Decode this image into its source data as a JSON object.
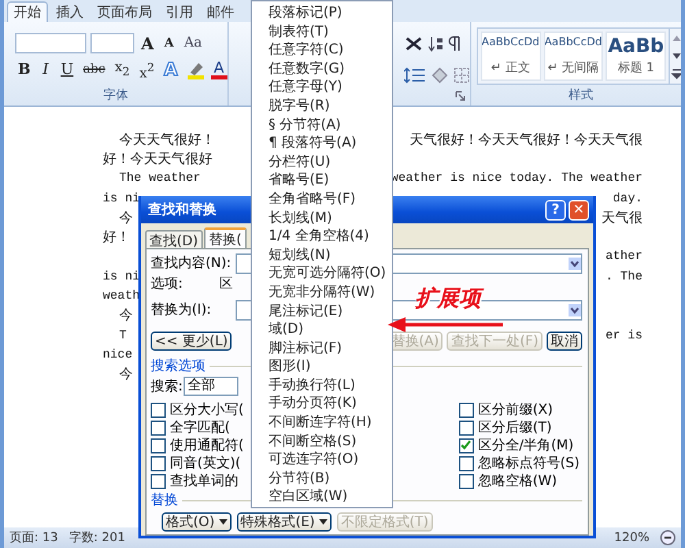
{
  "ribbon": {
    "tabs": [
      {
        "label": "开始",
        "selected": true
      },
      {
        "label": "插入",
        "selected": false
      },
      {
        "label": "页面布局",
        "selected": false
      },
      {
        "label": "引用",
        "selected": false
      },
      {
        "label": "邮件",
        "selected": false
      }
    ],
    "font_group": {
      "label": "字体",
      "row1": [
        {
          "kind": "grow",
          "text": "A"
        },
        {
          "kind": "shrink",
          "text": "A"
        },
        {
          "kind": "case",
          "text": "Aa"
        }
      ],
      "row2": [
        {
          "kind": "bold",
          "text": "B"
        },
        {
          "kind": "italic",
          "text": "I"
        },
        {
          "kind": "underline",
          "text": "U"
        },
        {
          "kind": "strike",
          "text": "abc"
        },
        {
          "kind": "plain",
          "text": "x$_{2}$"
        },
        {
          "kind": "plain",
          "text": "x$^{2}$"
        },
        {
          "kind": "effect",
          "text": "A"
        },
        {
          "kind": "highlight"
        },
        {
          "kind": "color",
          "text": "A"
        }
      ]
    },
    "styles": {
      "label": "样式",
      "items": [
        {
          "kind": "normal",
          "sample": "AaBbCcDd",
          "name": "↵ 正文"
        },
        {
          "kind": "normal",
          "sample": "AaBbCcDd",
          "name": "↵ 无间隔"
        },
        {
          "kind": "heading",
          "sample": "AaBb",
          "name": "标题 1"
        }
      ]
    }
  },
  "document": {
    "lines": [
      {
        "kind": "cjk",
        "indent": true,
        "left": "今天天气很好！",
        "right": "天气很好！今天天气很好！今天天气很"
      },
      {
        "kind": "cjk",
        "indent": false,
        "left": "好！今天天气很好"
      },
      {
        "kind": "latin",
        "indent": true,
        "left": "The weather",
        "right": "weather is nice today. The weather"
      },
      {
        "kind": "latin",
        "indent": false,
        "left": "is ni",
        "right": "day."
      },
      {
        "kind": "cjk",
        "indent": true,
        "left": "今",
        "right": "天气很"
      },
      {
        "kind": "cjk",
        "indent": false,
        "left": "好！"
      },
      {
        "kind": "latin",
        "indent": false,
        "right": "ather"
      },
      {
        "kind": "latin",
        "indent": false,
        "left": "is ni",
        "right": ". The"
      },
      {
        "kind": "latin",
        "indent": false,
        "left": "weath"
      },
      {
        "kind": "cjk",
        "indent": true,
        "left": "今"
      },
      {
        "kind": "latin",
        "indent": true,
        "left": "T",
        "right": "er is"
      },
      {
        "kind": "latin",
        "indent": false,
        "left": "nice"
      },
      {
        "kind": "cjk",
        "indent": true,
        "left": "今"
      }
    ]
  },
  "status_bar": {
    "page": "页面: 13",
    "words": "字数: 201",
    "zoom": "120%"
  },
  "dialog": {
    "title": "查找和替换",
    "title_buttons": [
      {
        "kind": "help",
        "text": "?"
      },
      {
        "kind": "close",
        "text": "✕"
      }
    ],
    "tabs": [
      {
        "label": "查找(D)",
        "selected": false
      },
      {
        "label": "替换(",
        "selected": true
      }
    ],
    "find_label": "查找内容(N):",
    "options_label": "选项:",
    "options_value": "区",
    "replace_label": "替换为(I):",
    "more_button": {
      "label": "<< 更少(L)",
      "disabled": false
    },
    "action_buttons": [
      {
        "label": "替换(A)",
        "disabled": true
      },
      {
        "label": "查找下一处(F)",
        "disabled": true
      },
      {
        "label": "取消",
        "disabled": false
      }
    ],
    "search_options": {
      "title": "搜索选项",
      "search_label": "搜索:",
      "search_value": "全部",
      "left": [
        {
          "label": "区分大小写(",
          "checked": false
        },
        {
          "label": "全字匹配(",
          "checked": false
        },
        {
          "label": "使用通配符(",
          "checked": false
        },
        {
          "label": "同音(英文)(",
          "checked": false
        },
        {
          "label": "查找单词的",
          "checked": false
        }
      ],
      "right": [
        {
          "label": "区分前缀(X)",
          "checked": false
        },
        {
          "label": "区分后缀(T)",
          "checked": false
        },
        {
          "label": "区分全/半角(M)",
          "checked": true
        },
        {
          "label": "忽略标点符号(S)",
          "checked": false
        },
        {
          "label": "忽略空格(W)",
          "checked": false
        }
      ]
    },
    "replace_section": {
      "title": "替换",
      "buttons": [
        {
          "label": "格式(O)",
          "dropdown": true,
          "disabled": false
        },
        {
          "label": "特殊格式(E)",
          "dropdown": true,
          "disabled": false
        },
        {
          "label": "不限定格式(T)",
          "dropdown": false,
          "disabled": true
        }
      ]
    }
  },
  "menu": {
    "items": [
      "段落标记(P)",
      "制表符(T)",
      "任意字符(C)",
      "任意数字(G)",
      "任意字母(Y)",
      "脱字号(R)",
      "§ 分节符(A)",
      "¶ 段落符号(A)",
      "分栏符(U)",
      "省略号(E)",
      "全角省略号(F)",
      "长划线(M)",
      "1/4 全角空格(4)",
      "短划线(N)",
      "无宽可选分隔符(O)",
      "无宽非分隔符(W)",
      "尾注标记(E)",
      "域(D)",
      "脚注标记(F)",
      "图形(I)",
      "手动换行符(L)",
      "手动分页符(K)",
      "不间断连字符(H)",
      "不间断空格(S)",
      "可选连字符(O)",
      "分节符(B)",
      "空白区域(W)"
    ]
  },
  "annotation": {
    "text": "扩展项"
  }
}
